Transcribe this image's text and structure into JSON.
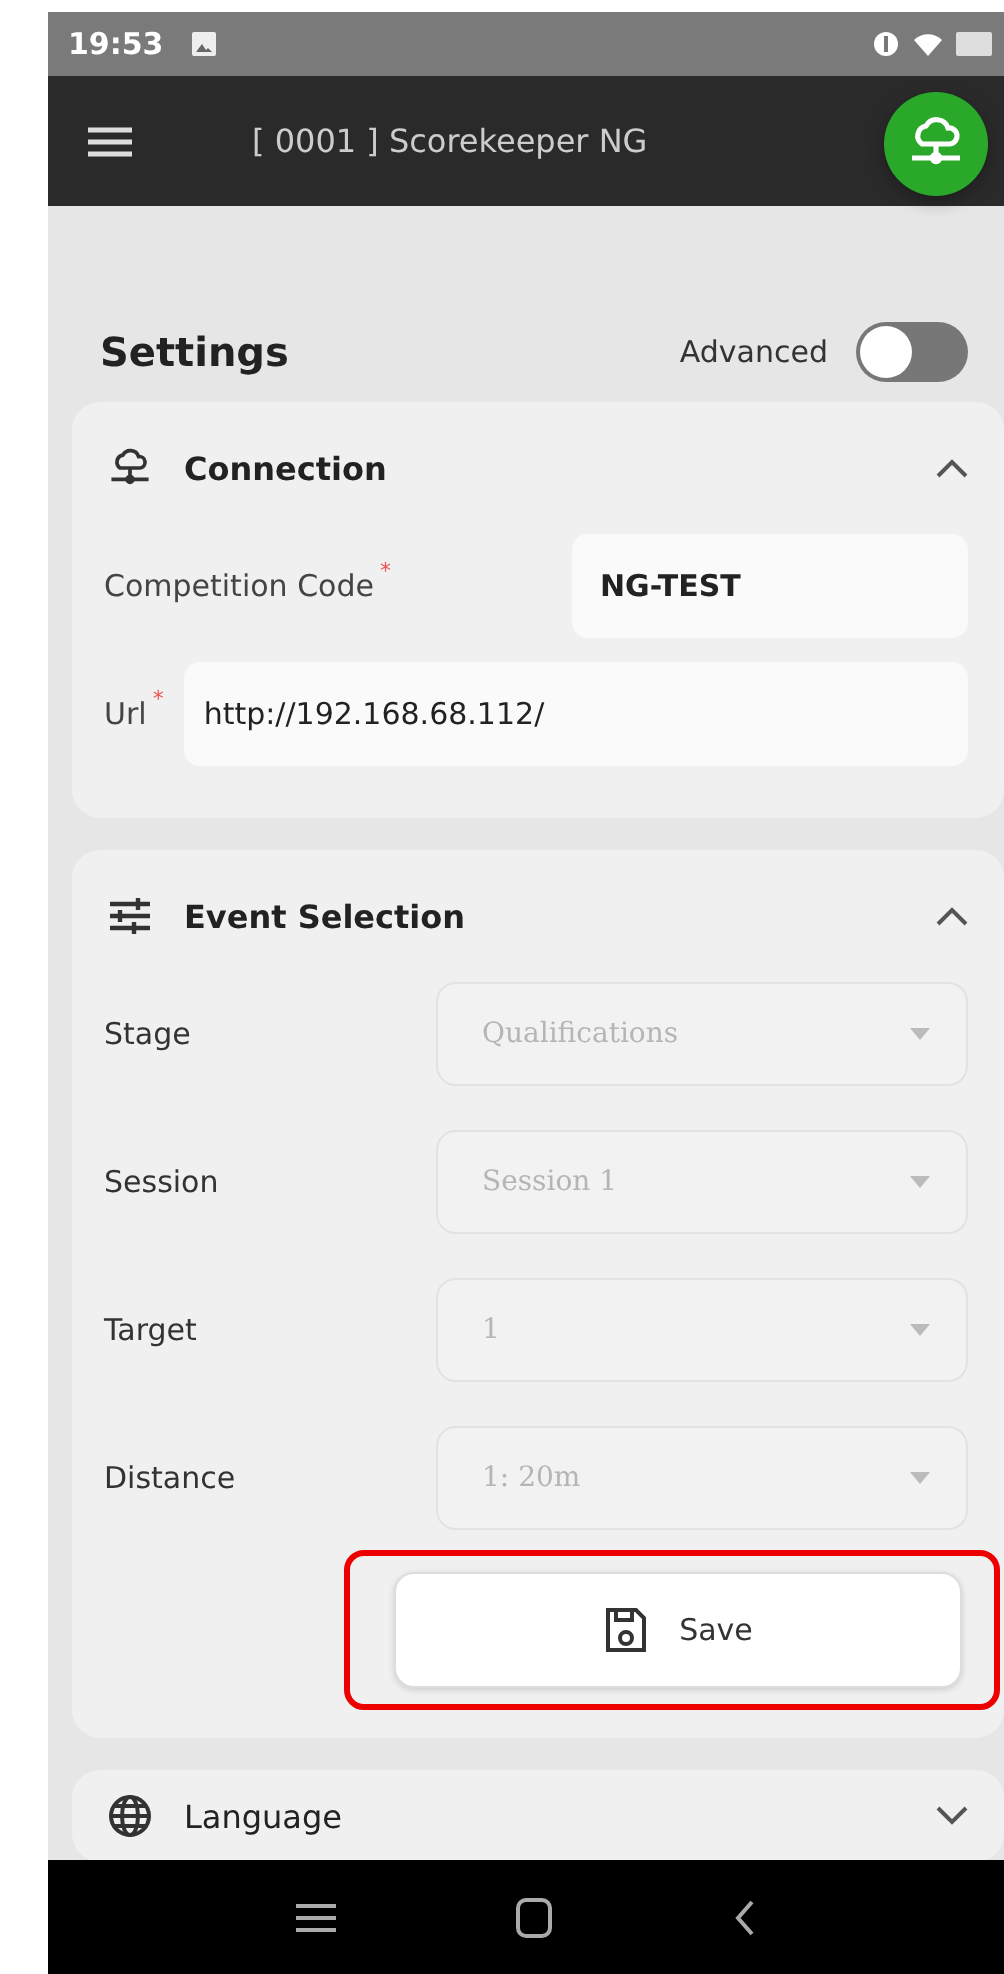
{
  "status_bar": {
    "time": "19:53"
  },
  "app_bar": {
    "title": "[ 0001 ] Scorekeeper NG"
  },
  "header": {
    "title": "Settings",
    "advanced": {
      "label": "Advanced",
      "on": false
    }
  },
  "connection": {
    "title": "Connection",
    "expanded": true,
    "fields": [
      {
        "label": "Competition Code",
        "required_mark": "*",
        "value": "NG-TEST",
        "kind": "short"
      },
      {
        "label": "Url",
        "required_mark": "*",
        "value": "http://192.168.68.112/",
        "kind": "wide"
      }
    ]
  },
  "event_selection": {
    "title": "Event Selection",
    "expanded": true,
    "fields": [
      {
        "label": "Stage",
        "value": "Qualifications",
        "disabled": true
      },
      {
        "label": "Session",
        "value": "Session 1",
        "disabled": true
      },
      {
        "label": "Target",
        "value": "1",
        "disabled": true
      },
      {
        "label": "Distance",
        "value": "1: 20m",
        "disabled": true
      }
    ],
    "save": {
      "label": "Save",
      "highlighted": true
    }
  },
  "language": {
    "title": "Language",
    "expanded": false
  }
}
